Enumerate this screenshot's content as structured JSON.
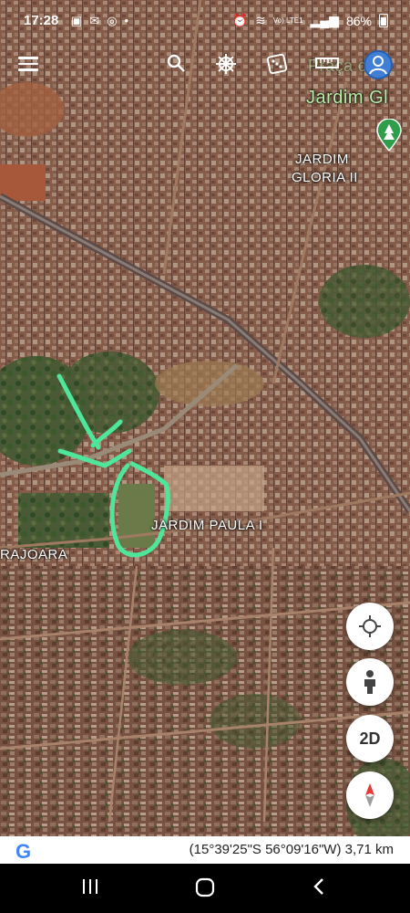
{
  "status_bar": {
    "time": "17:28",
    "network_label": "Vo) LTE1",
    "battery": "86%"
  },
  "toolbar": {
    "menu_icon": "hamburger-icon",
    "search_icon": "search-icon",
    "voyager_icon": "ship-wheel-icon",
    "random_icon": "dice-icon",
    "projects_icon": "ruler-icon",
    "faded_place_text": "Praça do J",
    "place_label": "Jardim Gl"
  },
  "map": {
    "labels": {
      "jardim_gloria_line1": "JARDIM",
      "jardim_gloria_line2": "GLORIA II",
      "jardim_paula": "JARDIM PAULA I",
      "rajoara": "RAJOARA"
    },
    "annotation_color": "#4ee69a"
  },
  "controls": {
    "locate_icon": "crosshair-icon",
    "streetview_icon": "pegman-icon",
    "mode_label": "2D",
    "compass_icon": "compass-icon"
  },
  "info_bar": {
    "logo": "G",
    "coordinates": "(15°39'25\"S 56°09'16\"W)",
    "scale": "3,71 km"
  },
  "nav_bar": {
    "recents_icon": "recents-icon",
    "home_icon": "home-icon",
    "back_icon": "back-icon"
  }
}
